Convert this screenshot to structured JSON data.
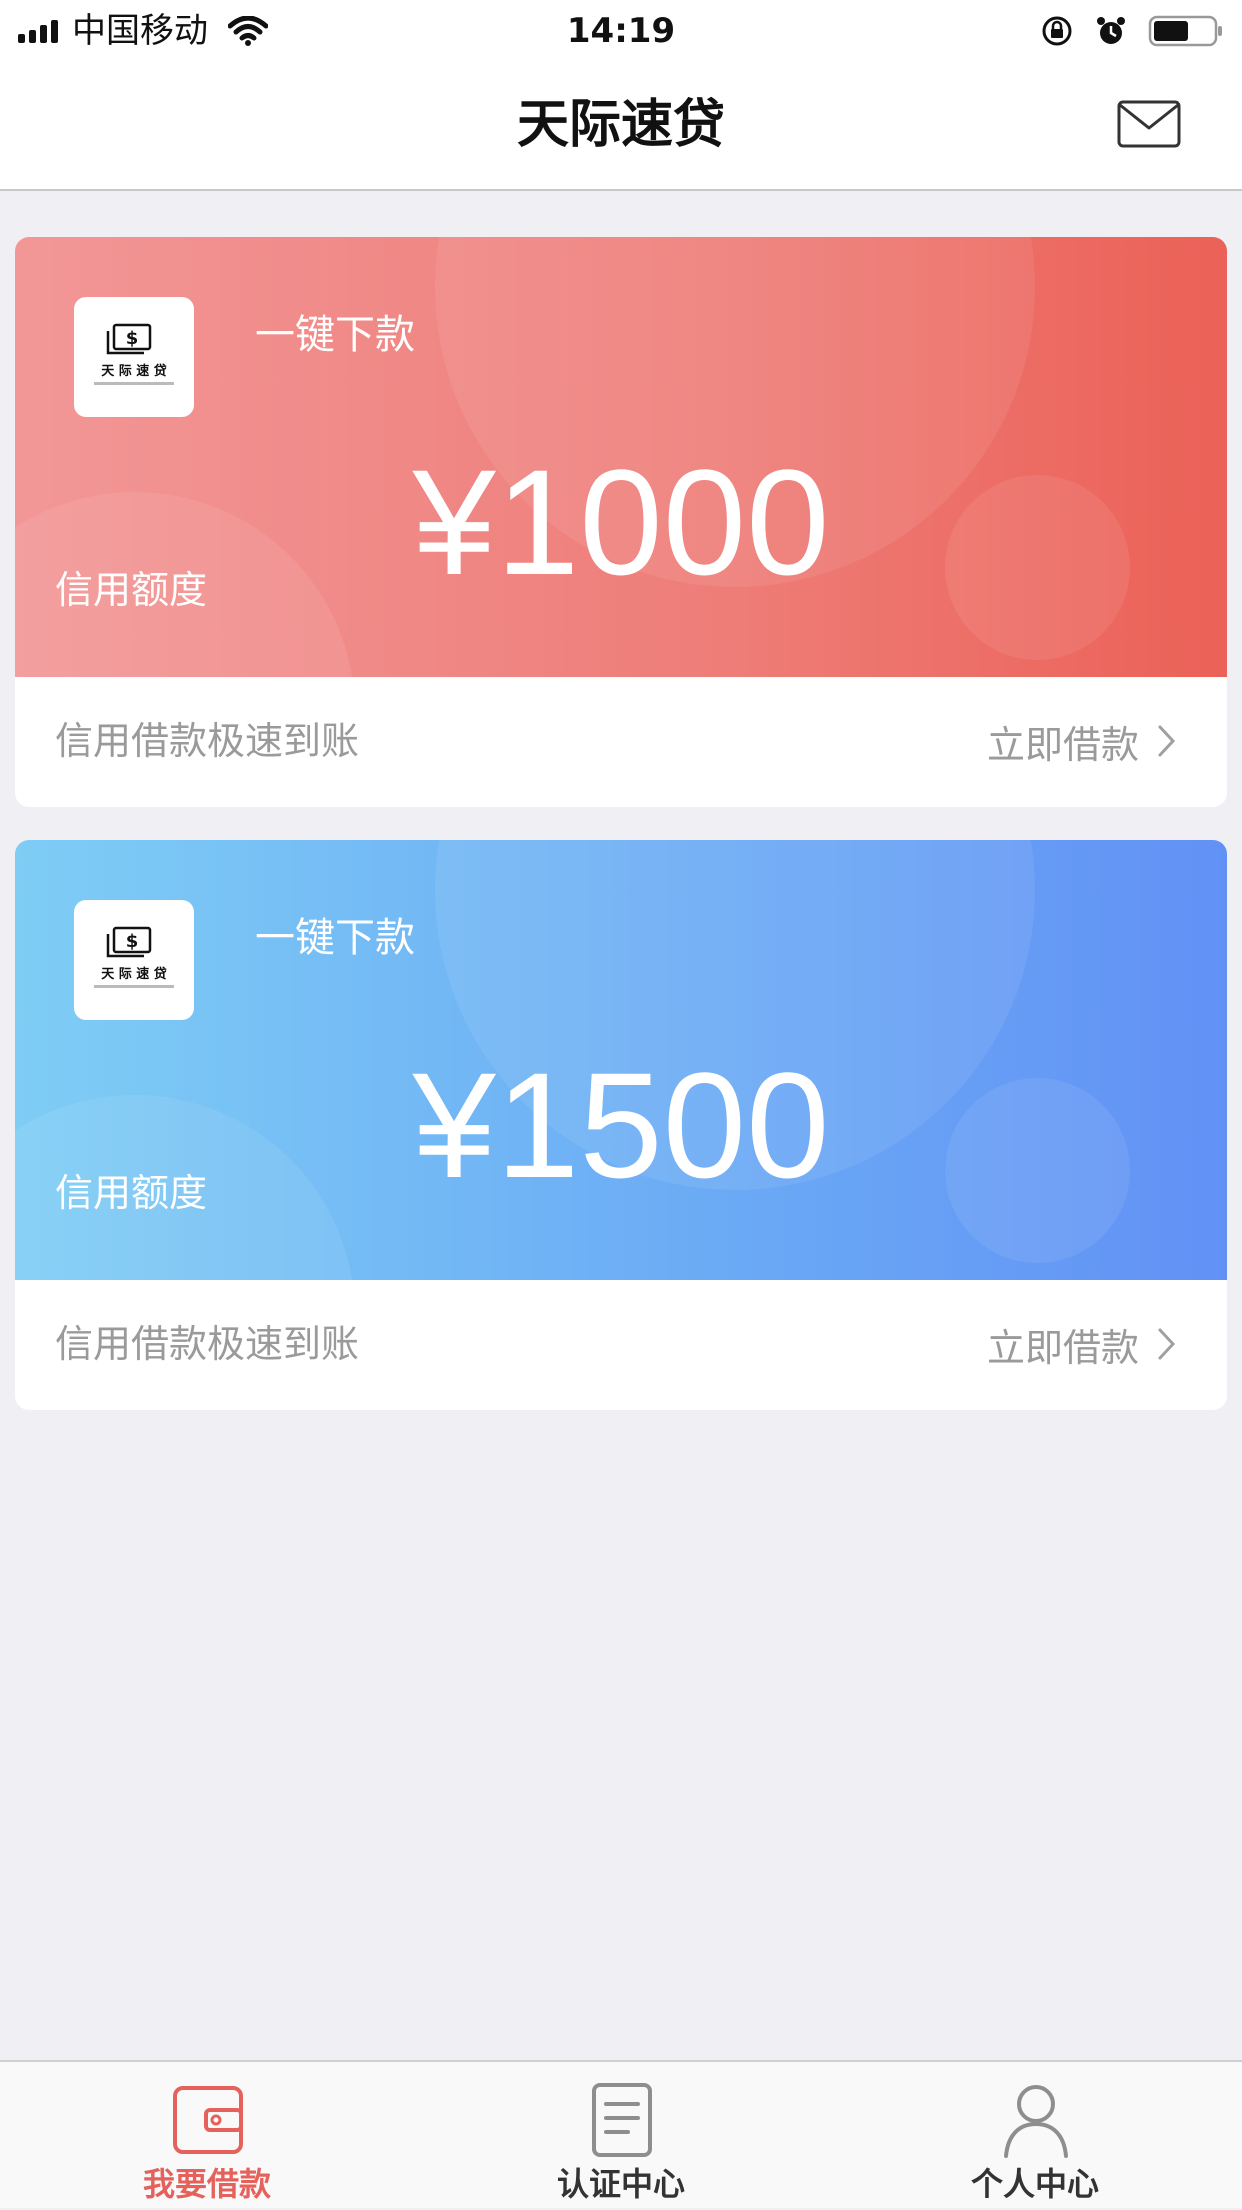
{
  "status_bar": {
    "carrier": "中国移动",
    "time": "14:19"
  },
  "header": {
    "title": "天际速贷"
  },
  "logo": {
    "name": "天 际 速 贷"
  },
  "cards": [
    {
      "subtitle": "一键下款",
      "amount": "¥1000",
      "label": "信用额度",
      "description": "信用借款极速到账",
      "action": "立即借款",
      "accent": "#ee7c77"
    },
    {
      "subtitle": "一键下款",
      "amount": "¥1500",
      "label": "信用额度",
      "description": "信用借款极速到账",
      "action": "立即借款",
      "accent": "#6aa9f5"
    }
  ],
  "tabs": [
    {
      "label": "我要借款",
      "icon": "wallet-icon",
      "active": true,
      "color": "#e5625c"
    },
    {
      "label": "认证中心",
      "icon": "document-icon",
      "active": false,
      "color": "#333333"
    },
    {
      "label": "个人中心",
      "icon": "person-icon",
      "active": false,
      "color": "#333333"
    }
  ]
}
